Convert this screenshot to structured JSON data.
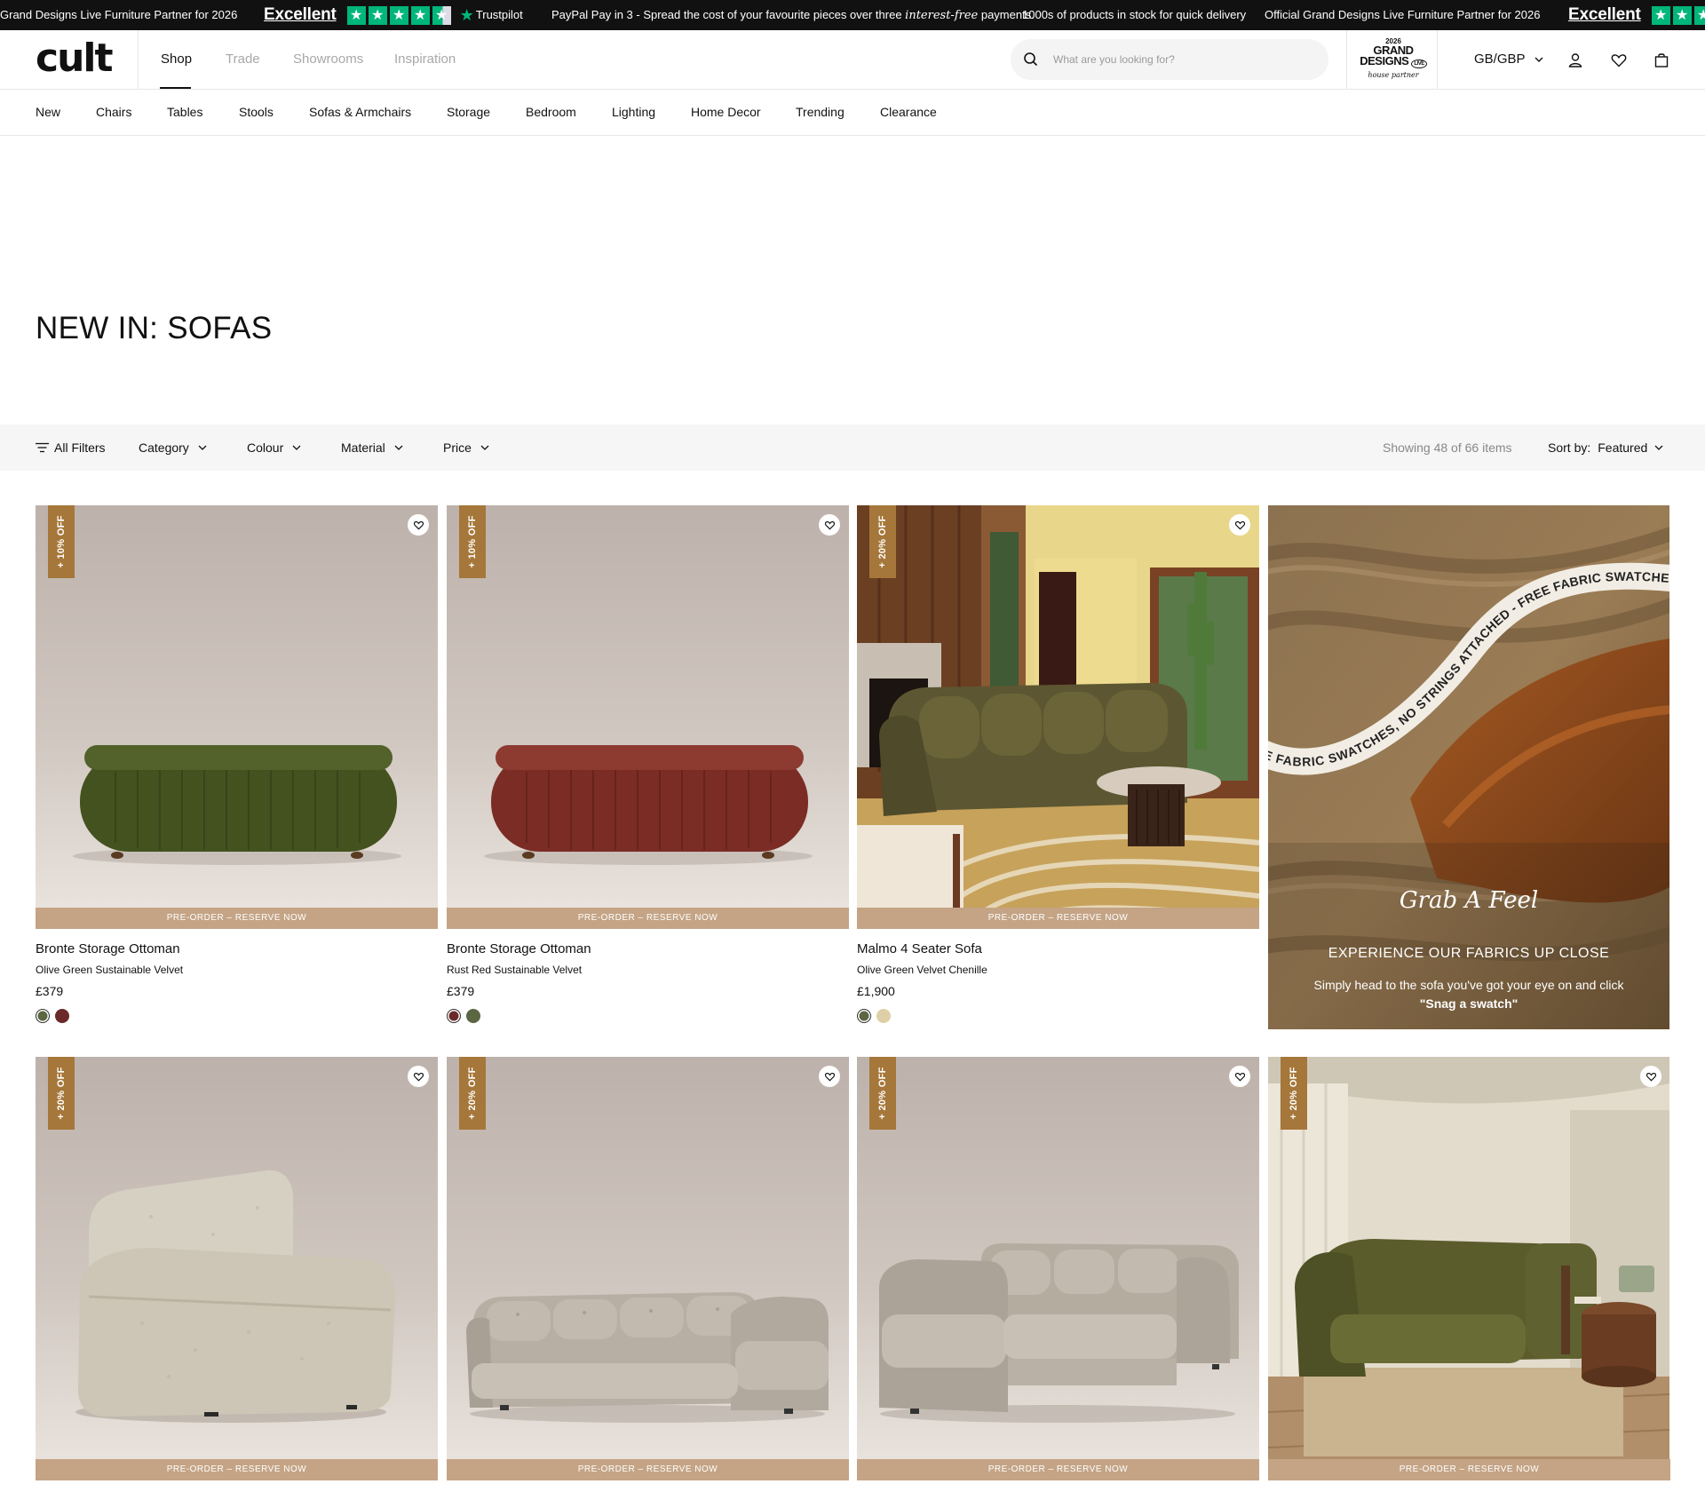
{
  "announcement": {
    "partner_text": "Official Grand Designs Live Furniture Partner for 2026",
    "partner_text_clipped": "Grand Designs Live Furniture Partner for 2026",
    "trustpilot_rating": "Excellent",
    "trustpilot_brand": "Trustpilot",
    "trustpilot_stars": 4.5,
    "paypal_text_pre": "PayPal Pay in 3 - Spread the cost of your favourite pieces over three ",
    "paypal_text_italic": "interest-free",
    "paypal_text_post": " payments.",
    "stock_text": "1000s of products in stock for quick delivery"
  },
  "header": {
    "logo": "cult",
    "nav": [
      "Shop",
      "Trade",
      "Showrooms",
      "Inspiration"
    ],
    "active_nav": "Shop",
    "search_placeholder": "What are you looking for?",
    "grand_designs": {
      "year": "2026",
      "line1": "GRAND",
      "line2": "DESIGNS",
      "live": "LIVE",
      "tagline": "house partner"
    },
    "currency": "GB/GBP",
    "icons": [
      "account-icon",
      "wishlist-icon",
      "bag-icon"
    ]
  },
  "categories": [
    "New",
    "Chairs",
    "Tables",
    "Stools",
    "Sofas & Armchairs",
    "Storage",
    "Bedroom",
    "Lighting",
    "Home Decor",
    "Trending",
    "Clearance"
  ],
  "page": {
    "title": "NEW IN: SOFAS"
  },
  "filters": {
    "all_filters": "All Filters",
    "dropdowns": [
      "Category",
      "Colour",
      "Material",
      "Price"
    ],
    "showing": "Showing 48 of 66 items",
    "sort_label": "Sort by:",
    "sort_value": "Featured"
  },
  "products": [
    {
      "badge": "+ 10% OFF",
      "preorder": "PRE-ORDER – RESERVE NOW",
      "name": "Bronte Storage Ottoman",
      "variant": "Olive Green Sustainable Velvet",
      "price": "£379",
      "swatches": [
        "#5b6642",
        "#6b2a2a"
      ],
      "selected_swatch": 0
    },
    {
      "badge": "+ 10% OFF",
      "preorder": "PRE-ORDER – RESERVE NOW",
      "name": "Bronte Storage Ottoman",
      "variant": "Rust Red Sustainable Velvet",
      "price": "£379",
      "swatches": [
        "#6b2a2a",
        "#5b6642"
      ],
      "selected_swatch": 0
    },
    {
      "badge": "+ 20% OFF",
      "preorder": "PRE-ORDER – RESERVE NOW",
      "name": "Malmo 4 Seater Sofa",
      "variant": "Olive Green Velvet Chenille",
      "price": "£1,900",
      "swatches": [
        "#5b6642",
        "#ddd0a6"
      ],
      "selected_swatch": 0
    },
    {
      "badge": "+ 20% OFF",
      "preorder": "PRE-ORDER – RESERVE NOW"
    },
    {
      "badge": "+ 20% OFF",
      "preorder": "PRE-ORDER – RESERVE NOW"
    },
    {
      "badge": "+ 20% OFF",
      "preorder": "PRE-ORDER – RESERVE NOW"
    },
    {
      "badge": "+ 20% OFF",
      "preorder": "PRE-ORDER – RESERVE NOW"
    }
  ],
  "promo": {
    "ribbon_text": "FREE FABRIC SWATCHES, NO STRINGS ATTACHED - FREE FABRIC SWATCHES, NO STRINGS ATTACHED - ",
    "script": "Grab A Feel",
    "heading": "EXPERIENCE OUR FABRICS UP CLOSE",
    "body": "Simply head to the sofa you've got your eye on and click",
    "cta": "\"Snag a swatch\""
  },
  "colors": {
    "badge": "#a6773a",
    "preorder_bar": "#c4a485",
    "announcement_bg": "#111111",
    "trustpilot_green": "#00b67a"
  }
}
